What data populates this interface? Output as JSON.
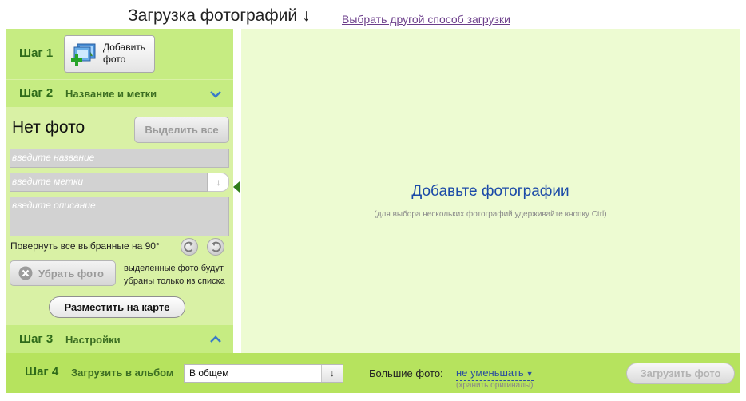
{
  "header": {
    "title": "Загрузка фотографий",
    "title_arrow": "↓",
    "alt_link": "Выбрать другой способ загрузки"
  },
  "step1": {
    "label": "Шаг 1",
    "add_button_line1": "Добавить",
    "add_button_line2": "фото"
  },
  "step2": {
    "label": "Шаг 2",
    "sub": "Название и метки",
    "no_photo": "Нет фото",
    "select_all": "Выделить все",
    "name_placeholder": "введите название",
    "tags_placeholder": "введите метки",
    "tags_button": "↓",
    "desc_placeholder": "введите описание",
    "rotate_label": "Повернуть все выбранные на 90°",
    "remove_button": "Убрать фото",
    "remove_note": "выделенные фото будут убраны только из списка",
    "map_button": "Разместить на карте"
  },
  "step3": {
    "label": "Шаг 3",
    "sub": "Настройки"
  },
  "main": {
    "add_photos_link": "Добавьте фотографии",
    "hint": "(для выбора нескольких фотографий удерживайте кнопку Ctrl)"
  },
  "step4": {
    "label": "Шаг 4",
    "album_label": "Загрузить в альбом",
    "album_value": "В общем",
    "album_button": "↓",
    "big_photo_label": "Большие фото:",
    "big_photo_value": "не уменьшать",
    "big_photo_caret": "▼",
    "keep_originals": "(хранить оригиналы)",
    "upload_button": "Загрузить фото"
  },
  "colors": {
    "panel_green": "#d9f1a5",
    "step_green": "#c6ec82",
    "main_bg": "#edfbd2",
    "bottom_bar": "#b6e35e",
    "link_blue": "#1b4aa8"
  }
}
